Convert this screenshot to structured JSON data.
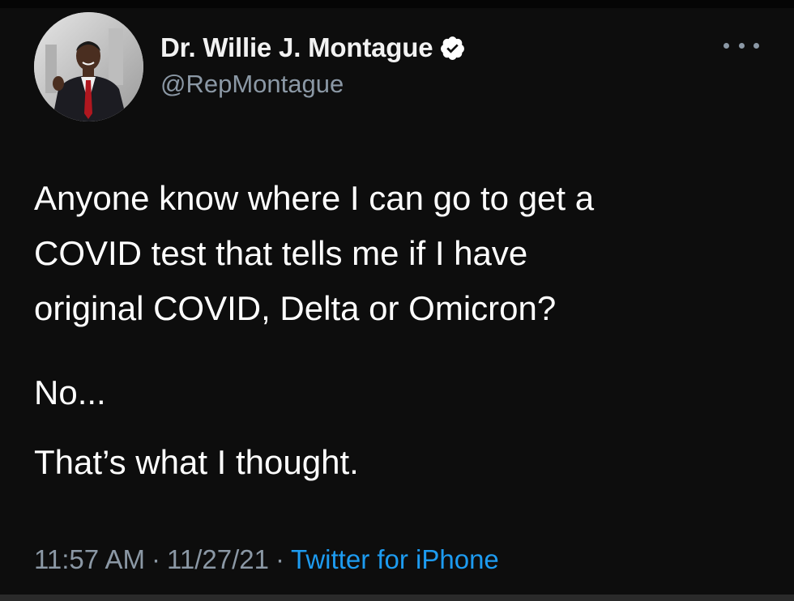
{
  "author": {
    "display_name": "Dr. Willie J. Montague",
    "handle": "@RepMontague",
    "verified": true,
    "avatar_icon": "profile-photo"
  },
  "more_icon": "more-horizontal-icon",
  "tweet": {
    "lines": [
      "Anyone know where I can go to get a",
      "COVID test that tells me if I have",
      "original COVID, Delta or Omicron?",
      "No...",
      "That’s what I thought."
    ]
  },
  "meta": {
    "time": "11:57 AM",
    "date": "11/27/21",
    "separator": "·",
    "source": "Twitter for iPhone"
  },
  "colors": {
    "background": "#0d0d0d",
    "text": "#ffffff",
    "secondary": "#8b98a5",
    "link": "#1d9bf0"
  }
}
